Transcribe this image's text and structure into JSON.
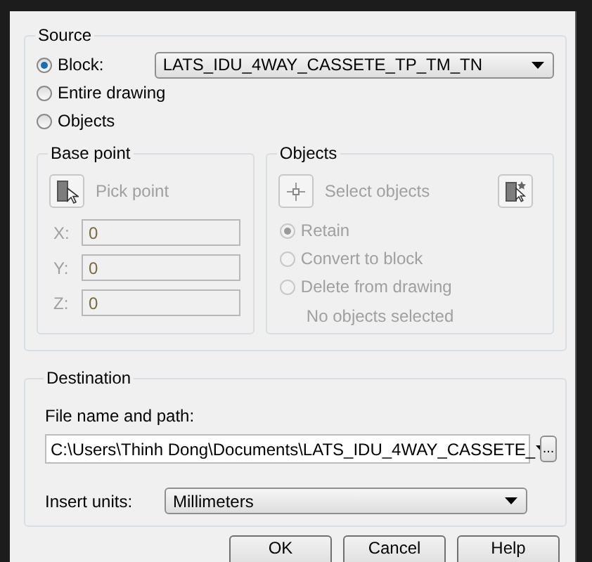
{
  "source": {
    "title": "Source",
    "options": [
      {
        "label": "Block:",
        "selected": true
      },
      {
        "label": "Entire drawing",
        "selected": false
      },
      {
        "label": "Objects",
        "selected": false
      }
    ],
    "block_name": "LATS_IDU_4WAY_CASSETE_TP_TM_TN"
  },
  "base_point": {
    "title": "Base point",
    "disabled": true,
    "pick_label": "Pick point",
    "coords": [
      {
        "axis": "X:",
        "value": "0"
      },
      {
        "axis": "Y:",
        "value": "0"
      },
      {
        "axis": "Z:",
        "value": "0"
      }
    ]
  },
  "objects": {
    "title": "Objects",
    "disabled": true,
    "select_label": "Select objects",
    "options": [
      {
        "label": "Retain",
        "selected": true
      },
      {
        "label": "Convert to block",
        "selected": false
      },
      {
        "label": "Delete from drawing",
        "selected": false
      }
    ],
    "status": "No objects selected"
  },
  "destination": {
    "title": "Destination",
    "path_label": "File name and path:",
    "path": "C:\\Users\\Thinh Dong\\Documents\\LATS_IDU_4WAY_CASSETE_",
    "browse": "...",
    "units_label": "Insert units:",
    "units": "Millimeters"
  },
  "buttons": [
    "OK",
    "Cancel",
    "Help"
  ]
}
